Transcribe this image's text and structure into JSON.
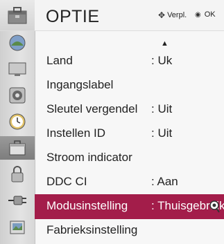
{
  "header": {
    "title": "OPTIE",
    "hint_move": "Verpl.",
    "hint_ok": "OK",
    "title_icon": "option-toolbox-icon"
  },
  "sidebar": {
    "icons": [
      "picture-icon",
      "screen-icon",
      "audio-icon",
      "time-icon",
      "option-icon",
      "lock-icon",
      "input-icon",
      "photo-icon"
    ],
    "active_index": 4
  },
  "menu": {
    "scroll_indicator": "▲",
    "items": [
      {
        "label": "Land",
        "value": ": Uk"
      },
      {
        "label": "Ingangslabel",
        "value": ""
      },
      {
        "label": "Sleutel vergendel",
        "value": ": Uit"
      },
      {
        "label": "Instellen ID",
        "value": ": Uit"
      },
      {
        "label": "Stroom indicator",
        "value": ""
      },
      {
        "label": "DDC CI",
        "value": ": Aan"
      },
      {
        "label": "Modusinstelling",
        "value": ": Thuisgebruik"
      },
      {
        "label": "Fabrieksinstelling",
        "value": ""
      }
    ],
    "selected_index": 6
  },
  "colors": {
    "selection": "#a31d4a",
    "background": "#f7f7f7"
  }
}
